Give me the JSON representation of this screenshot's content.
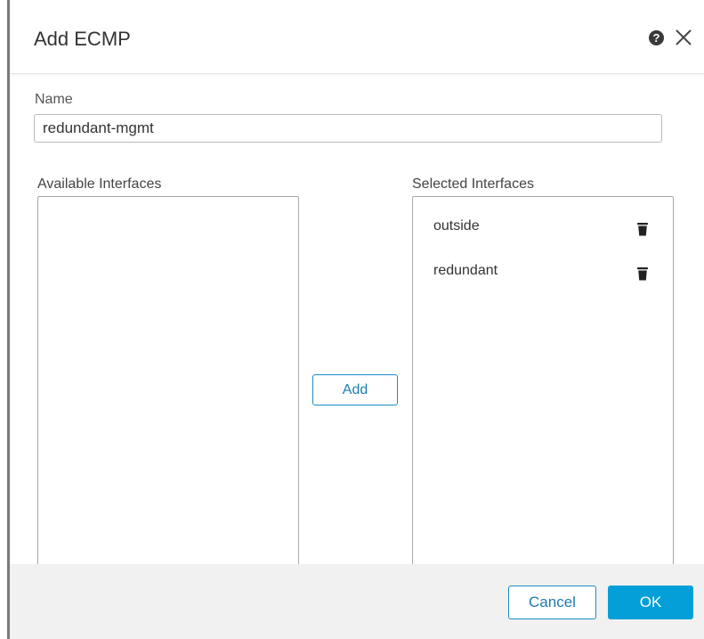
{
  "dialog": {
    "title": "Add ECMP",
    "help_icon": "help-circle-icon",
    "close_icon": "close-icon"
  },
  "name_field": {
    "label": "Name",
    "value": "redundant-mgmt"
  },
  "available_interfaces": {
    "label": "Available Interfaces",
    "items": []
  },
  "selected_interfaces": {
    "label": "Selected Interfaces",
    "items": [
      {
        "label": "outside",
        "icon": "trash-icon"
      },
      {
        "label": "redundant",
        "icon": "trash-icon"
      }
    ]
  },
  "actions": {
    "add_label": "Add",
    "cancel_label": "Cancel",
    "ok_label": "OK"
  },
  "colors": {
    "accent": "#049fd9",
    "link": "#1a7cb0",
    "footer_bg": "#f1f1f1"
  }
}
